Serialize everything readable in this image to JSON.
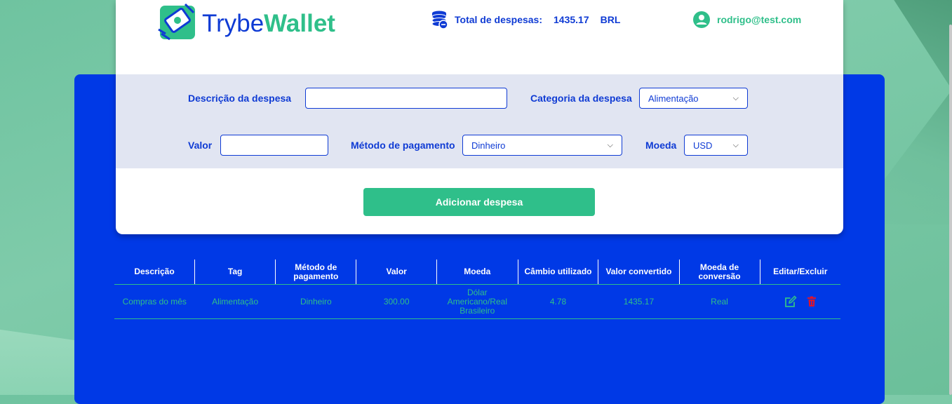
{
  "logo": {
    "part1": "Trybe",
    "part2": "Wallet"
  },
  "header": {
    "total_label": "Total de despesas:",
    "total_value": "1435.17",
    "currency": "BRL",
    "user_email": "rodrigo@test.com"
  },
  "form": {
    "description_label": "Descrição da despesa",
    "description_value": "",
    "category_label": "Categoria da despesa",
    "category_value": "Alimentação",
    "value_label": "Valor",
    "value_value": "",
    "method_label": "Método de pagamento",
    "method_value": "Dinheiro",
    "currency_label": "Moeda",
    "currency_value": "USD",
    "add_button": "Adicionar despesa"
  },
  "table": {
    "headers": [
      "Descrição",
      "Tag",
      "Método de pagamento",
      "Valor",
      "Moeda",
      "Câmbio utilizado",
      "Valor convertido",
      "Moeda de conversão",
      "Editar/Excluir"
    ],
    "rows": [
      {
        "description": "Compras do mês",
        "tag": "Alimentação",
        "method": "Dinheiro",
        "value": "300.00",
        "currency": "Dólar Americano/Real Brasileiro",
        "rate": "4.78",
        "converted": "1435.17",
        "conversion_currency": "Real"
      }
    ]
  },
  "colors": {
    "primary": "#0039e6",
    "accent": "#2fbf8a",
    "delete": "#e0152b"
  }
}
